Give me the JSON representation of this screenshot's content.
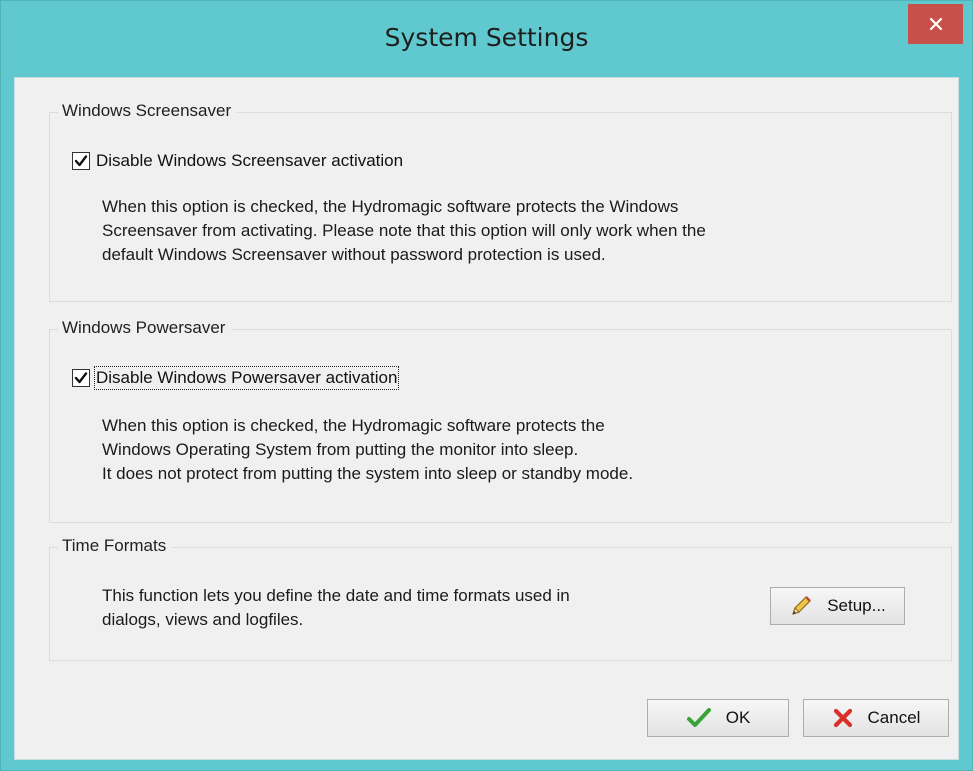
{
  "window": {
    "title": "System Settings"
  },
  "icons": {
    "close": "close-icon",
    "check": "checkbox-check-icon",
    "pencil": "pencil-icon",
    "ok": "green-check-icon",
    "cancel": "red-x-icon"
  },
  "colors": {
    "titlebar": "#5fc9cf",
    "close_button": "#c8504a",
    "client": "#f0f0f0",
    "ok_check": "#3aa33a",
    "cancel_x": "#d9302c"
  },
  "screensaver": {
    "group_title": "Windows Screensaver",
    "checkbox_label": "Disable Windows Screensaver activation",
    "checked": true,
    "description": [
      "When this option is checked, the Hydromagic software protects the Windows",
      "Screensaver from activating. Please note that this option will only work when the",
      "default Windows Screensaver without password protection is used."
    ]
  },
  "powersaver": {
    "group_title": "Windows Powersaver",
    "checkbox_label": "Disable Windows Powersaver activation",
    "checked": true,
    "description": [
      "When this option is checked, the Hydromagic software protects the",
      "Windows Operating System from putting the monitor into sleep.",
      "It does not protect from putting the system into sleep or standby mode."
    ]
  },
  "time_formats": {
    "group_title": "Time Formats",
    "description": [
      "This function lets you define the date and time formats used in",
      "dialogs, views and logfiles."
    ],
    "setup_label": "Setup..."
  },
  "footer": {
    "ok_label": "OK",
    "cancel_label": "Cancel"
  }
}
